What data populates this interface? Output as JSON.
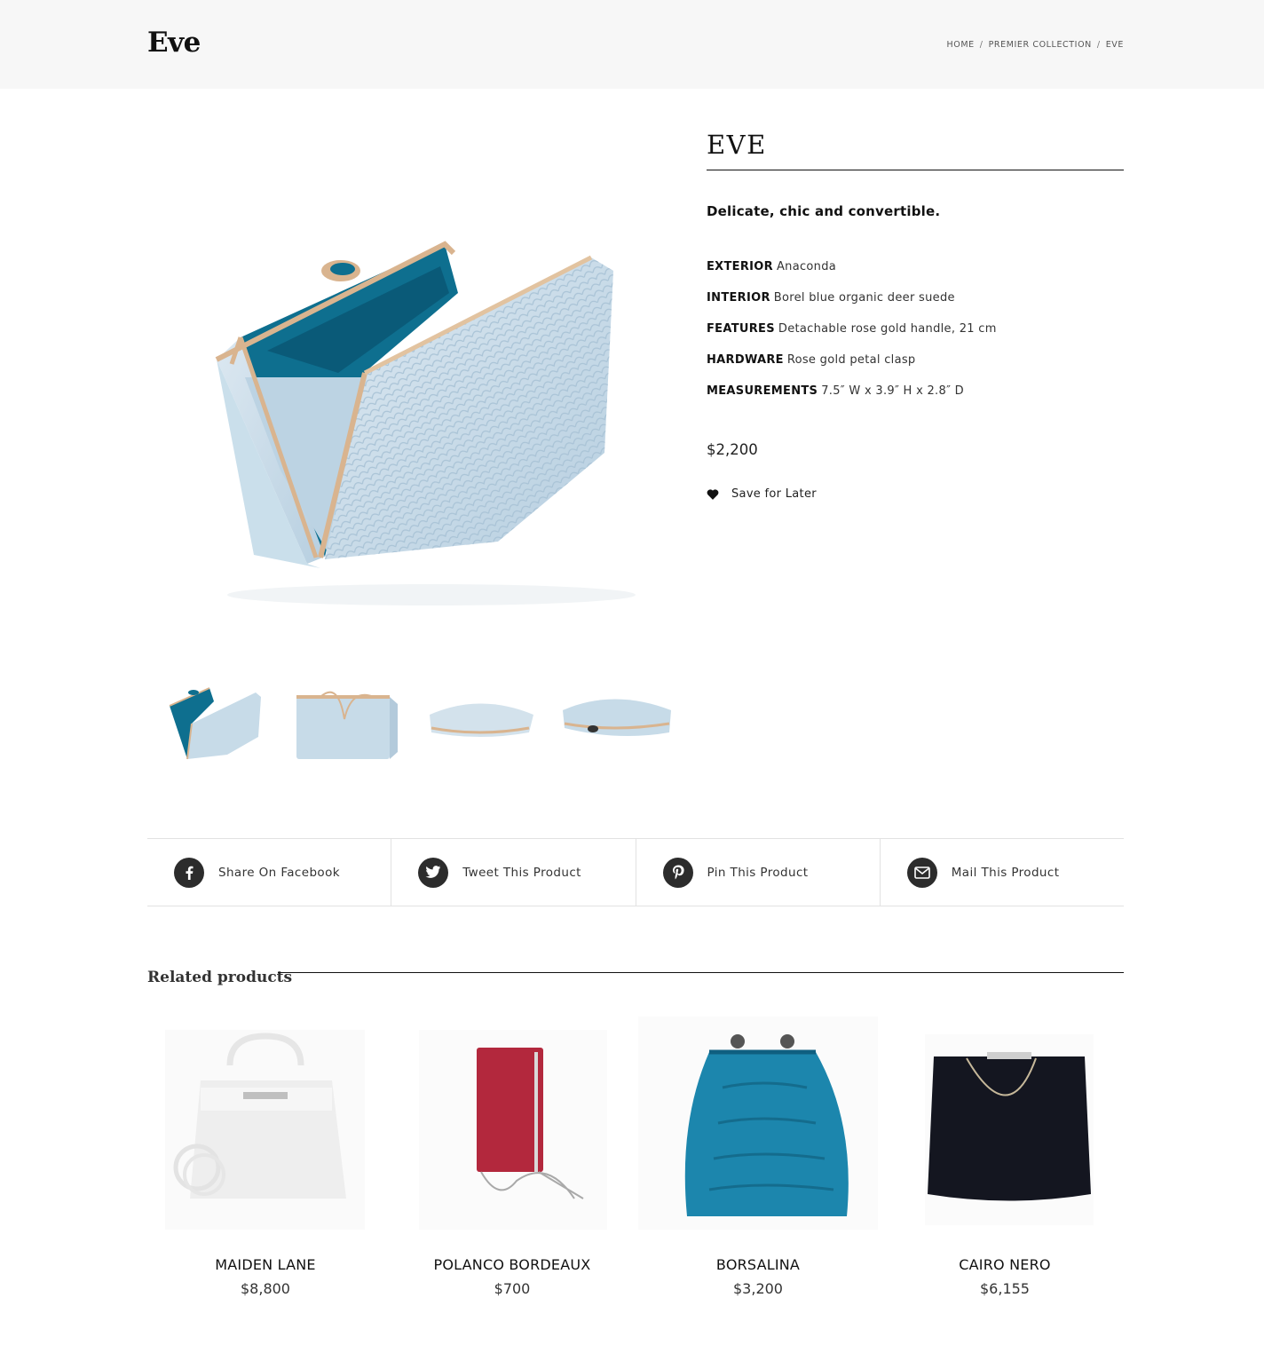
{
  "header": {
    "title": "Eve",
    "breadcrumb": {
      "home": "HOME",
      "collection": "PREMIER COLLECTION",
      "current": "EVE"
    }
  },
  "product": {
    "name": "EVE",
    "tagline": "Delicate, chic and convertible.",
    "specs": [
      {
        "key": "EXTERIOR",
        "value": "Anaconda"
      },
      {
        "key": "INTERIOR",
        "value": "Borel blue organic deer suede"
      },
      {
        "key": "FEATURES",
        "value": "Detachable rose gold handle, 21 cm"
      },
      {
        "key": "HARDWARE",
        "value": "Rose gold petal clasp"
      },
      {
        "key": "MEASUREMENTS",
        "value": "7.5″ W x 3.9″ H x 2.8″ D"
      }
    ],
    "price": "$2,200",
    "save_label": "Save for Later",
    "save_icon": "heart-icon"
  },
  "share": [
    {
      "label": "Share On Facebook",
      "icon": "facebook-icon"
    },
    {
      "label": "Tweet This Product",
      "icon": "twitter-icon"
    },
    {
      "label": "Pin This Product",
      "icon": "pinterest-icon"
    },
    {
      "label": "Mail This Product",
      "icon": "mail-icon"
    }
  ],
  "related": {
    "title": "Related products",
    "items": [
      {
        "name": "MAIDEN LANE",
        "price": "$8,800"
      },
      {
        "name": "POLANCO BORDEAUX",
        "price": "$700"
      },
      {
        "name": "BORSALINA",
        "price": "$3,200"
      },
      {
        "name": "CAIRO NERO",
        "price": "$6,155"
      }
    ]
  },
  "colors": {
    "header_bg": "#f7f7f7",
    "icon_dark": "#2c2c2c",
    "bag_blue_pale": "#c9dbe8",
    "suede_blue": "#0e6f8f",
    "rose_gold": "#d9b48f",
    "bordeaux": "#b3283d",
    "borsalina_blue": "#1c86ad",
    "cairo_black": "#141620"
  }
}
